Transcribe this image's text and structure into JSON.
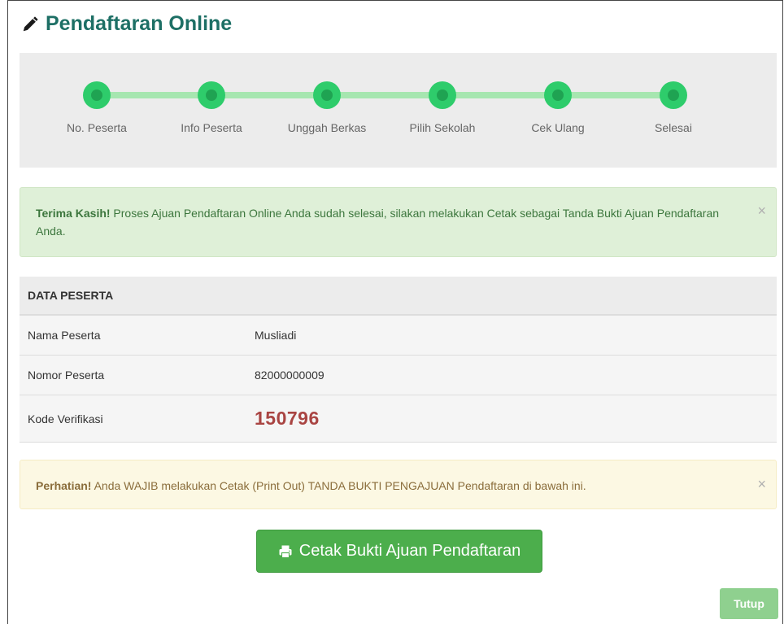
{
  "header": {
    "title": "Pendaftaran Online",
    "icon": "pencil-icon"
  },
  "steps": [
    {
      "label": "No. Peserta"
    },
    {
      "label": "Info Peserta"
    },
    {
      "label": "Unggah Berkas"
    },
    {
      "label": "Pilih Sekolah"
    },
    {
      "label": "Cek Ulang"
    },
    {
      "label": "Selesai"
    }
  ],
  "success_alert": {
    "strong": "Terima Kasih!",
    "text": " Proses Ajuan Pendaftaran Online Anda sudah selesai, silakan melakukan Cetak sebagai Tanda Bukti Ajuan Pendaftaran Anda.",
    "close": "×"
  },
  "table": {
    "header": "DATA PESERTA",
    "rows": [
      {
        "label": "Nama Peserta",
        "value": "Musliadi"
      },
      {
        "label": "Nomor Peserta",
        "value": "82000000009"
      },
      {
        "label": "Kode Verifikasi",
        "value": "150796"
      }
    ]
  },
  "warning_alert": {
    "strong": "Perhatian!",
    "text": " Anda WAJIB melakukan Cetak (Print Out) TANDA BUKTI PENGAJUAN Pendaftaran di bawah ini.",
    "close": "×"
  },
  "print_button": {
    "label": "Cetak Bukti Ajuan Pendaftaran",
    "icon": "printer-icon"
  },
  "close_button": {
    "label": "Tutup"
  },
  "colors": {
    "title": "#1d6f65",
    "step_active": "#2ecc6b",
    "track": "#a6e6b0",
    "success_bg": "#dff0d8",
    "warning_bg": "#fcf8e3",
    "code": "#a94442",
    "button": "#4cae4c"
  }
}
